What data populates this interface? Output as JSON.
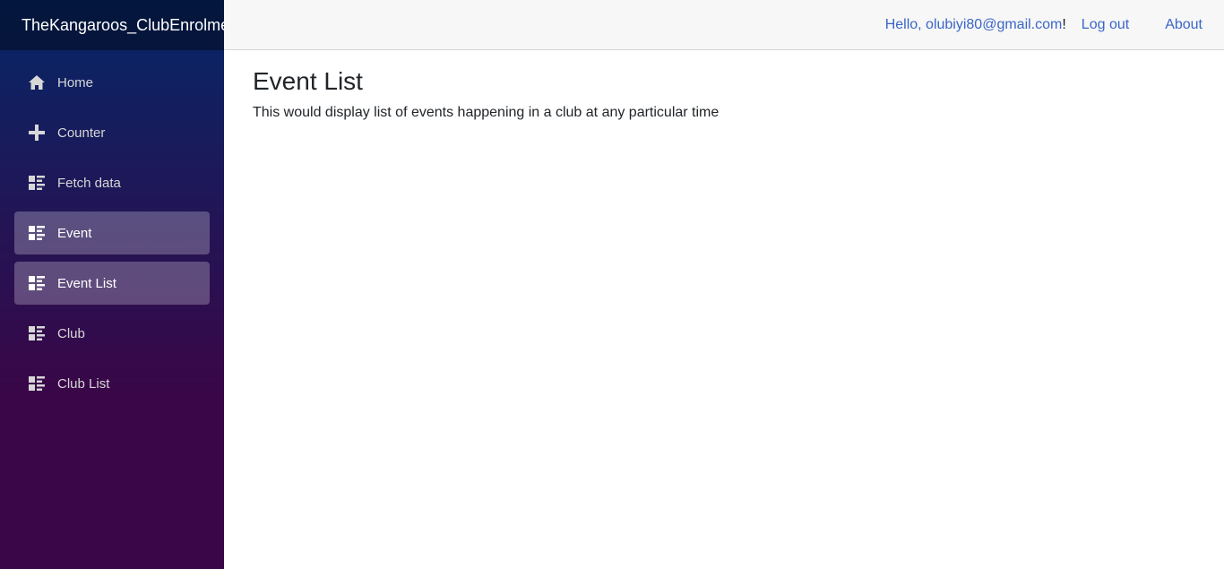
{
  "app": {
    "brand": "TheKangaroos_ClubEnrolme"
  },
  "topbar": {
    "hello_label": "Hello, olubiyi80@gmail.com",
    "hello_suffix": "!",
    "logout_label": "Log out",
    "about_label": "About"
  },
  "sidebar": {
    "items": [
      {
        "label": "Home",
        "icon": "home-icon",
        "active": false
      },
      {
        "label": "Counter",
        "icon": "plus-icon",
        "active": false
      },
      {
        "label": "Fetch data",
        "icon": "list-rich-icon",
        "active": false
      },
      {
        "label": "Event",
        "icon": "list-rich-icon",
        "active": true
      },
      {
        "label": "Event List",
        "icon": "list-rich-icon",
        "active": true
      },
      {
        "label": "Club",
        "icon": "list-rich-icon",
        "active": false
      },
      {
        "label": "Club List",
        "icon": "list-rich-icon",
        "active": false
      }
    ]
  },
  "main": {
    "title": "Event List",
    "description": "This would display list of events happening in a club at any particular time"
  },
  "colors": {
    "sidebar_top": "#052767",
    "sidebar_bottom": "#3a0647",
    "link": "#3a66c6",
    "topbar_bg": "#f7f7f7"
  }
}
